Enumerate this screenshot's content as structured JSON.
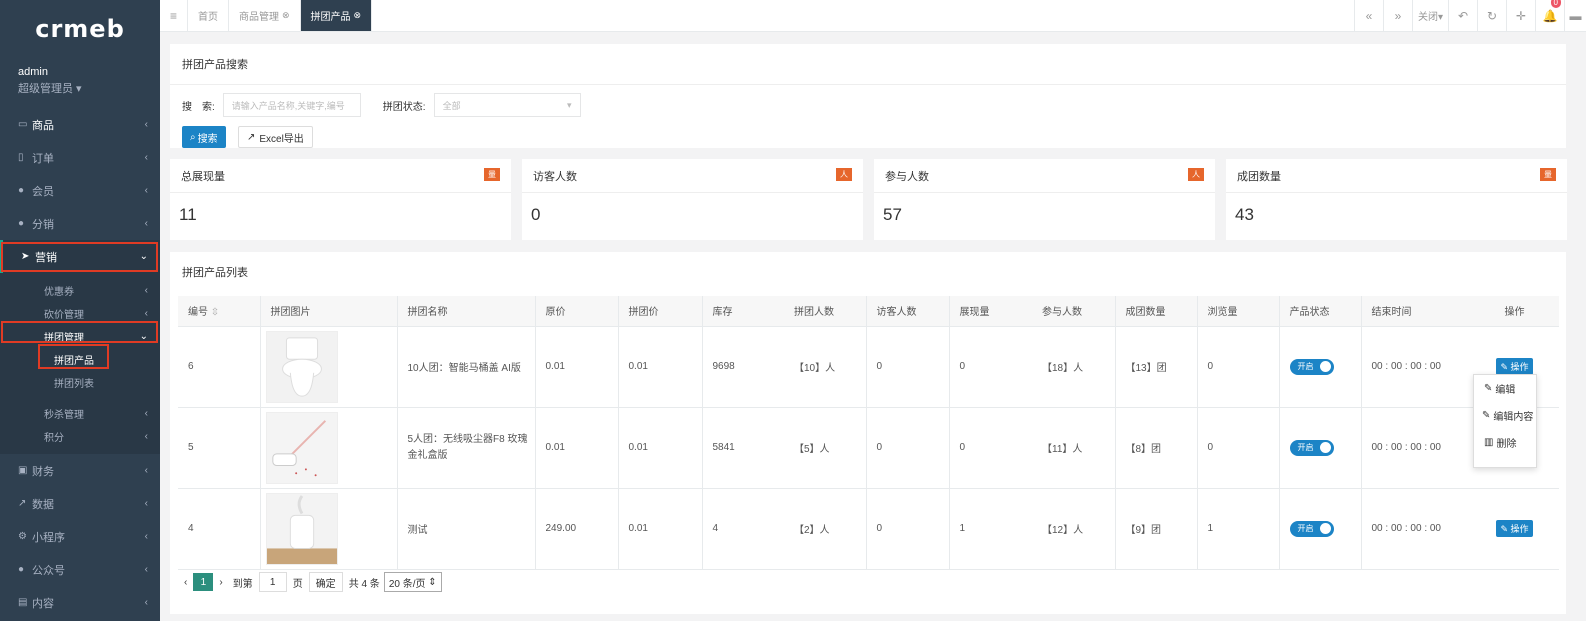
{
  "sidebar": {
    "logo": "crmeb",
    "user_name": "admin",
    "user_role": "超级管理员 ▾",
    "menu": [
      {
        "label": "商品",
        "icon": "laptop-icon"
      },
      {
        "label": "订单",
        "icon": "receipt-icon"
      },
      {
        "label": "会员",
        "icon": "user-icon"
      },
      {
        "label": "分销",
        "icon": "users-icon"
      },
      {
        "label": "营销",
        "icon": "paper-plane-icon"
      },
      {
        "label": "财务",
        "icon": "money-icon"
      },
      {
        "label": "数据",
        "icon": "chart-icon"
      },
      {
        "label": "小程序",
        "icon": "miniprogram-icon"
      },
      {
        "label": "公众号",
        "icon": "wechat-icon"
      },
      {
        "label": "内容",
        "icon": "content-icon"
      }
    ],
    "marketing_sub": [
      {
        "label": "优惠券"
      },
      {
        "label": "砍价管理"
      },
      {
        "label": "拼团管理"
      },
      {
        "label": "秒杀管理"
      },
      {
        "label": "积分"
      }
    ],
    "groupbuy_sub": [
      {
        "label": "拼团产品"
      },
      {
        "label": "拼团列表"
      }
    ]
  },
  "topbar": {
    "tabs": [
      {
        "label": "首页"
      },
      {
        "label": "商品管理"
      },
      {
        "label": "拼团产品"
      }
    ],
    "close_label": "关闭▾",
    "notification_count": "0"
  },
  "search": {
    "title": "拼团产品搜索",
    "keyword_label": "搜　索:",
    "keyword_placeholder": "请输入产品名称,关键字,编号",
    "status_label": "拼团状态:",
    "status_value": "全部",
    "search_button": "搜索",
    "export_button": "Excel导出"
  },
  "stats": [
    {
      "title": "总展现量",
      "badge": "量",
      "value": "11"
    },
    {
      "title": "访客人数",
      "badge": "人",
      "value": "0"
    },
    {
      "title": "参与人数",
      "badge": "人",
      "value": "57"
    },
    {
      "title": "成团数量",
      "badge": "量",
      "value": "43"
    }
  ],
  "list": {
    "title": "拼团产品列表",
    "columns": [
      "编号",
      "拼团图片",
      "拼团名称",
      "原价",
      "拼团价",
      "库存",
      "拼团人数",
      "访客人数",
      "展现量",
      "参与人数",
      "成团数量",
      "浏览量",
      "产品状态",
      "结束时间",
      "操作"
    ],
    "rows": [
      {
        "id": "6",
        "name": "10人团：智能马桶盖 AI版",
        "price": "0.01",
        "group_price": "0.01",
        "stock": "9698",
        "people": "【10】人",
        "visitors": "0",
        "views": "0",
        "participants": "【18】人",
        "groups": "【13】团",
        "browse": "0",
        "status": "开启",
        "end_time": "00 : 00 : 00 : 00",
        "op": "操作"
      },
      {
        "id": "5",
        "name": "5人团：无线吸尘器F8 玫瑰金礼盒版",
        "price": "0.01",
        "group_price": "0.01",
        "stock": "5841",
        "people": "【5】人",
        "visitors": "0",
        "views": "0",
        "participants": "【11】人",
        "groups": "【8】团",
        "browse": "0",
        "status": "开启",
        "end_time": "00 : 00 : 00 : 00",
        "op": ""
      },
      {
        "id": "4",
        "name": "测试",
        "price": "249.00",
        "group_price": "0.01",
        "stock": "4",
        "people": "【2】人",
        "visitors": "0",
        "views": "1",
        "participants": "【12】人",
        "groups": "【9】团",
        "browse": "1",
        "status": "开启",
        "end_time": "00 : 00 : 00 : 00",
        "op": "操作"
      }
    ]
  },
  "dropdown": {
    "items": [
      "编辑",
      "编辑内容",
      "删除"
    ]
  },
  "pager": {
    "current": "1",
    "goto_label": "到第",
    "goto_value": "1",
    "page_unit": "页",
    "confirm": "确定",
    "total": "共 4 条",
    "page_size": "20 条/页"
  }
}
